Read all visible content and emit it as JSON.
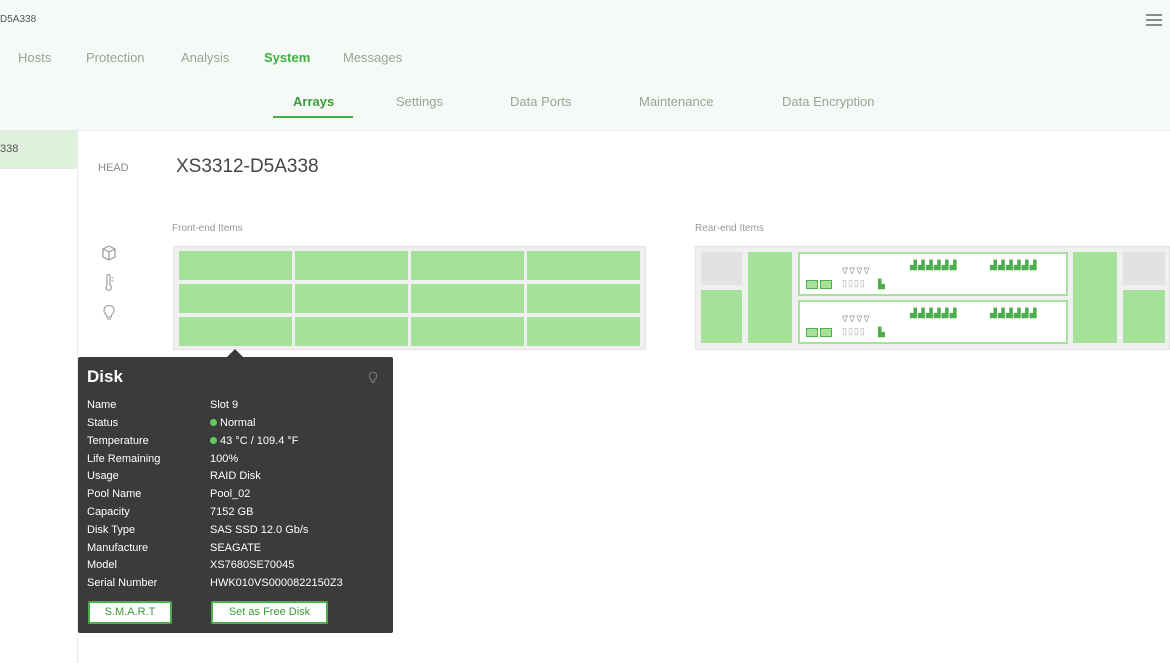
{
  "window": {
    "device_title": "D5A338"
  },
  "nav": {
    "main": [
      "Hosts",
      "Protection",
      "Analysis",
      "System",
      "Messages"
    ],
    "active_main": "System",
    "sub": [
      "Arrays",
      "Settings",
      "Data Ports",
      "Maintenance",
      "Data Encryption"
    ],
    "active_sub": "Arrays"
  },
  "sidebar": {
    "items": [
      {
        "label": "338",
        "selected": true
      }
    ]
  },
  "array": {
    "head_label": "HEAD",
    "title": "XS3312-D5A338",
    "front_label": "Front-end Items",
    "rear_label": "Rear-end Items",
    "side_icons": [
      "box-icon",
      "thermometer-icon",
      "bulb-icon"
    ]
  },
  "colors": {
    "accent": "#3fae3f",
    "slot_fill": "#a6e19a",
    "tooltip_bg": "#3b3b3b",
    "status_ok": "#5fce5f"
  },
  "tooltip": {
    "title": "Disk",
    "rows": [
      {
        "label": "Name",
        "value": "Slot 9"
      },
      {
        "label": "Status",
        "value": "Normal"
      },
      {
        "label": "Temperature",
        "value": "43 °C / 109.4 °F"
      },
      {
        "label": "Life Remaining",
        "value": "100%"
      },
      {
        "label": "Usage",
        "value": "RAID Disk"
      },
      {
        "label": "Pool Name",
        "value": "Pool_02"
      },
      {
        "label": "Capacity",
        "value": "7152 GB"
      },
      {
        "label": "Disk Type",
        "value": "SAS SSD 12.0 Gb/s"
      },
      {
        "label": "Manufacture",
        "value": "SEAGATE"
      },
      {
        "label": "Model",
        "value": "XS7680SE70045"
      },
      {
        "label": "Serial Number",
        "value": "HWK010VS0000822150Z3"
      }
    ],
    "smart_button": "S.M.A.R.T",
    "free_button": "Set as Free Disk"
  }
}
